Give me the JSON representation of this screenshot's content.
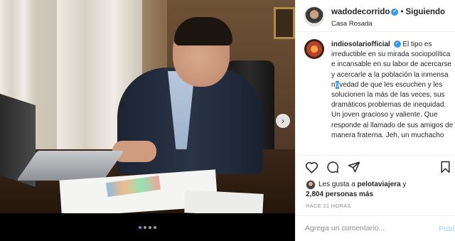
{
  "post": {
    "username": "wadodecorrido",
    "verified_symbol": "✓",
    "separator": "•",
    "follow_status": "Siguiendo",
    "location": "Casa Rosada"
  },
  "comment": {
    "username": "indiosolariofficial",
    "verified_symbol": "✓",
    "text_before": " El tipo es irreductible en su mirada sociopolítica e incansable en su labor de acercarse y acercarle a la población la inmensa n",
    "text_selected": "o",
    "text_after": "vedad de que les escuchen y les solucionen la más de las veces, sus dramáticos problemas de inequidad. Un joven gracioso y valiente. Que responde al llamado de sus amigos de manera fraterna. Jeh, un muchacho"
  },
  "likes": {
    "prefix": "Les gusta a ",
    "first_user": "pelotaviajera",
    "middle": " y",
    "count_text": "2,804 personas más"
  },
  "timestamp": "HACE 21 HORAS",
  "comment_box": {
    "placeholder": "Agrega un comentario...",
    "publish_label": "Publicar"
  },
  "carousel": {
    "dots": 4,
    "active_index": 0
  },
  "colors": {
    "accent": "#3897f0",
    "publish_disabled": "#b2dffc",
    "muted": "#8e8e8e"
  },
  "icons": [
    "heart-icon",
    "comment-icon",
    "share-icon",
    "bookmark-icon",
    "chevron-right-icon",
    "verified-badge-icon"
  ]
}
